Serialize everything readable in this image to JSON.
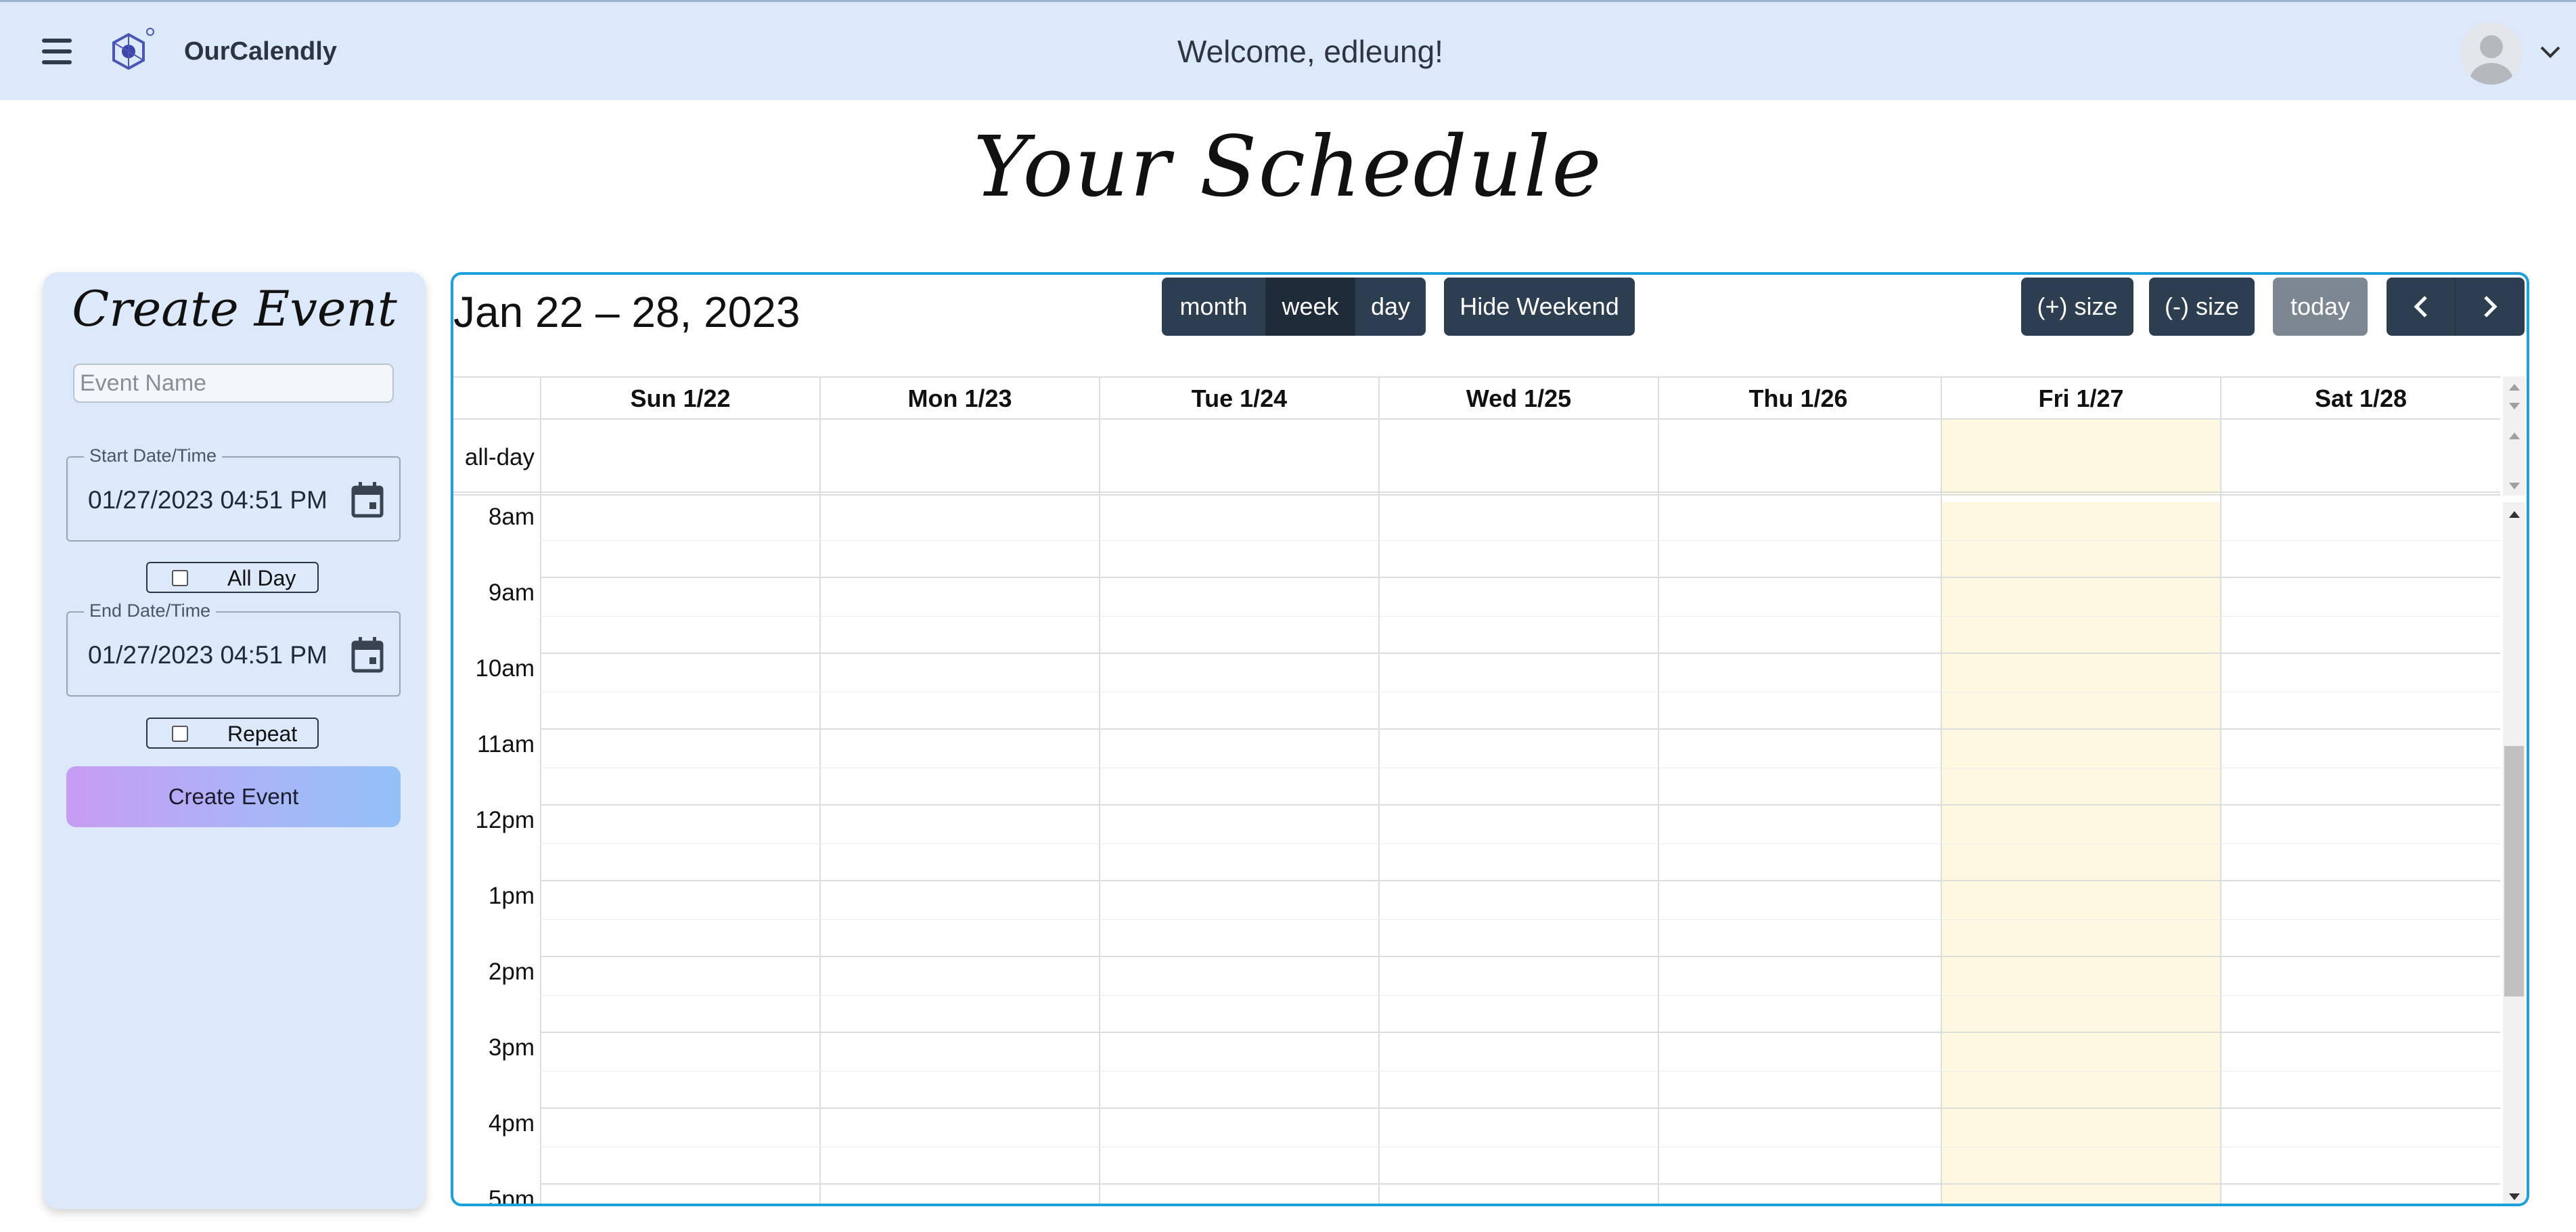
{
  "navbar": {
    "brand": "OurCalendly",
    "welcome": "Welcome, edleung!",
    "icons": [
      "hamburger-menu-icon",
      "brand-logo-icon",
      "avatar-icon",
      "chevron-down-icon"
    ]
  },
  "page": {
    "title": "Your Schedule"
  },
  "create_event": {
    "title": "Create Event",
    "event_name_placeholder": "Event Name",
    "event_name_value": "",
    "start_label": "Start Date/Time",
    "start_value": "01/27/2023 04:51 PM",
    "all_day_label": "All Day",
    "all_day_checked": false,
    "end_label": "End Date/Time",
    "end_value": "01/27/2023 04:51 PM",
    "repeat_label": "Repeat",
    "repeat_checked": false,
    "submit_label": "Create Event"
  },
  "calendar": {
    "title": "Jan 22 – 28, 2023",
    "view_buttons": [
      {
        "label": "month",
        "active": false
      },
      {
        "label": "week",
        "active": true
      },
      {
        "label": "day",
        "active": false
      }
    ],
    "hide_weekend_label": "Hide Weekend",
    "size_plus_label": "(+) size",
    "size_minus_label": "(-) size",
    "today_label": "today",
    "days": [
      "Sun 1/22",
      "Mon 1/23",
      "Tue 1/24",
      "Wed 1/25",
      "Thu 1/26",
      "Fri 1/27",
      "Sat 1/28"
    ],
    "today_index": 5,
    "allday_label": "all-day",
    "hours": [
      "8am",
      "9am",
      "10am",
      "11am",
      "12pm",
      "1pm",
      "2pm",
      "3pm",
      "4pm",
      "5pm"
    ]
  },
  "colors": {
    "navbar_bg": "#dbe9fb",
    "calendar_border": "#1ea0dc",
    "button_bg": "#2c3e50",
    "button_active_bg": "#1e2b38",
    "today_button_bg": "#7c8792",
    "today_column_bg": "#fdf8df"
  }
}
